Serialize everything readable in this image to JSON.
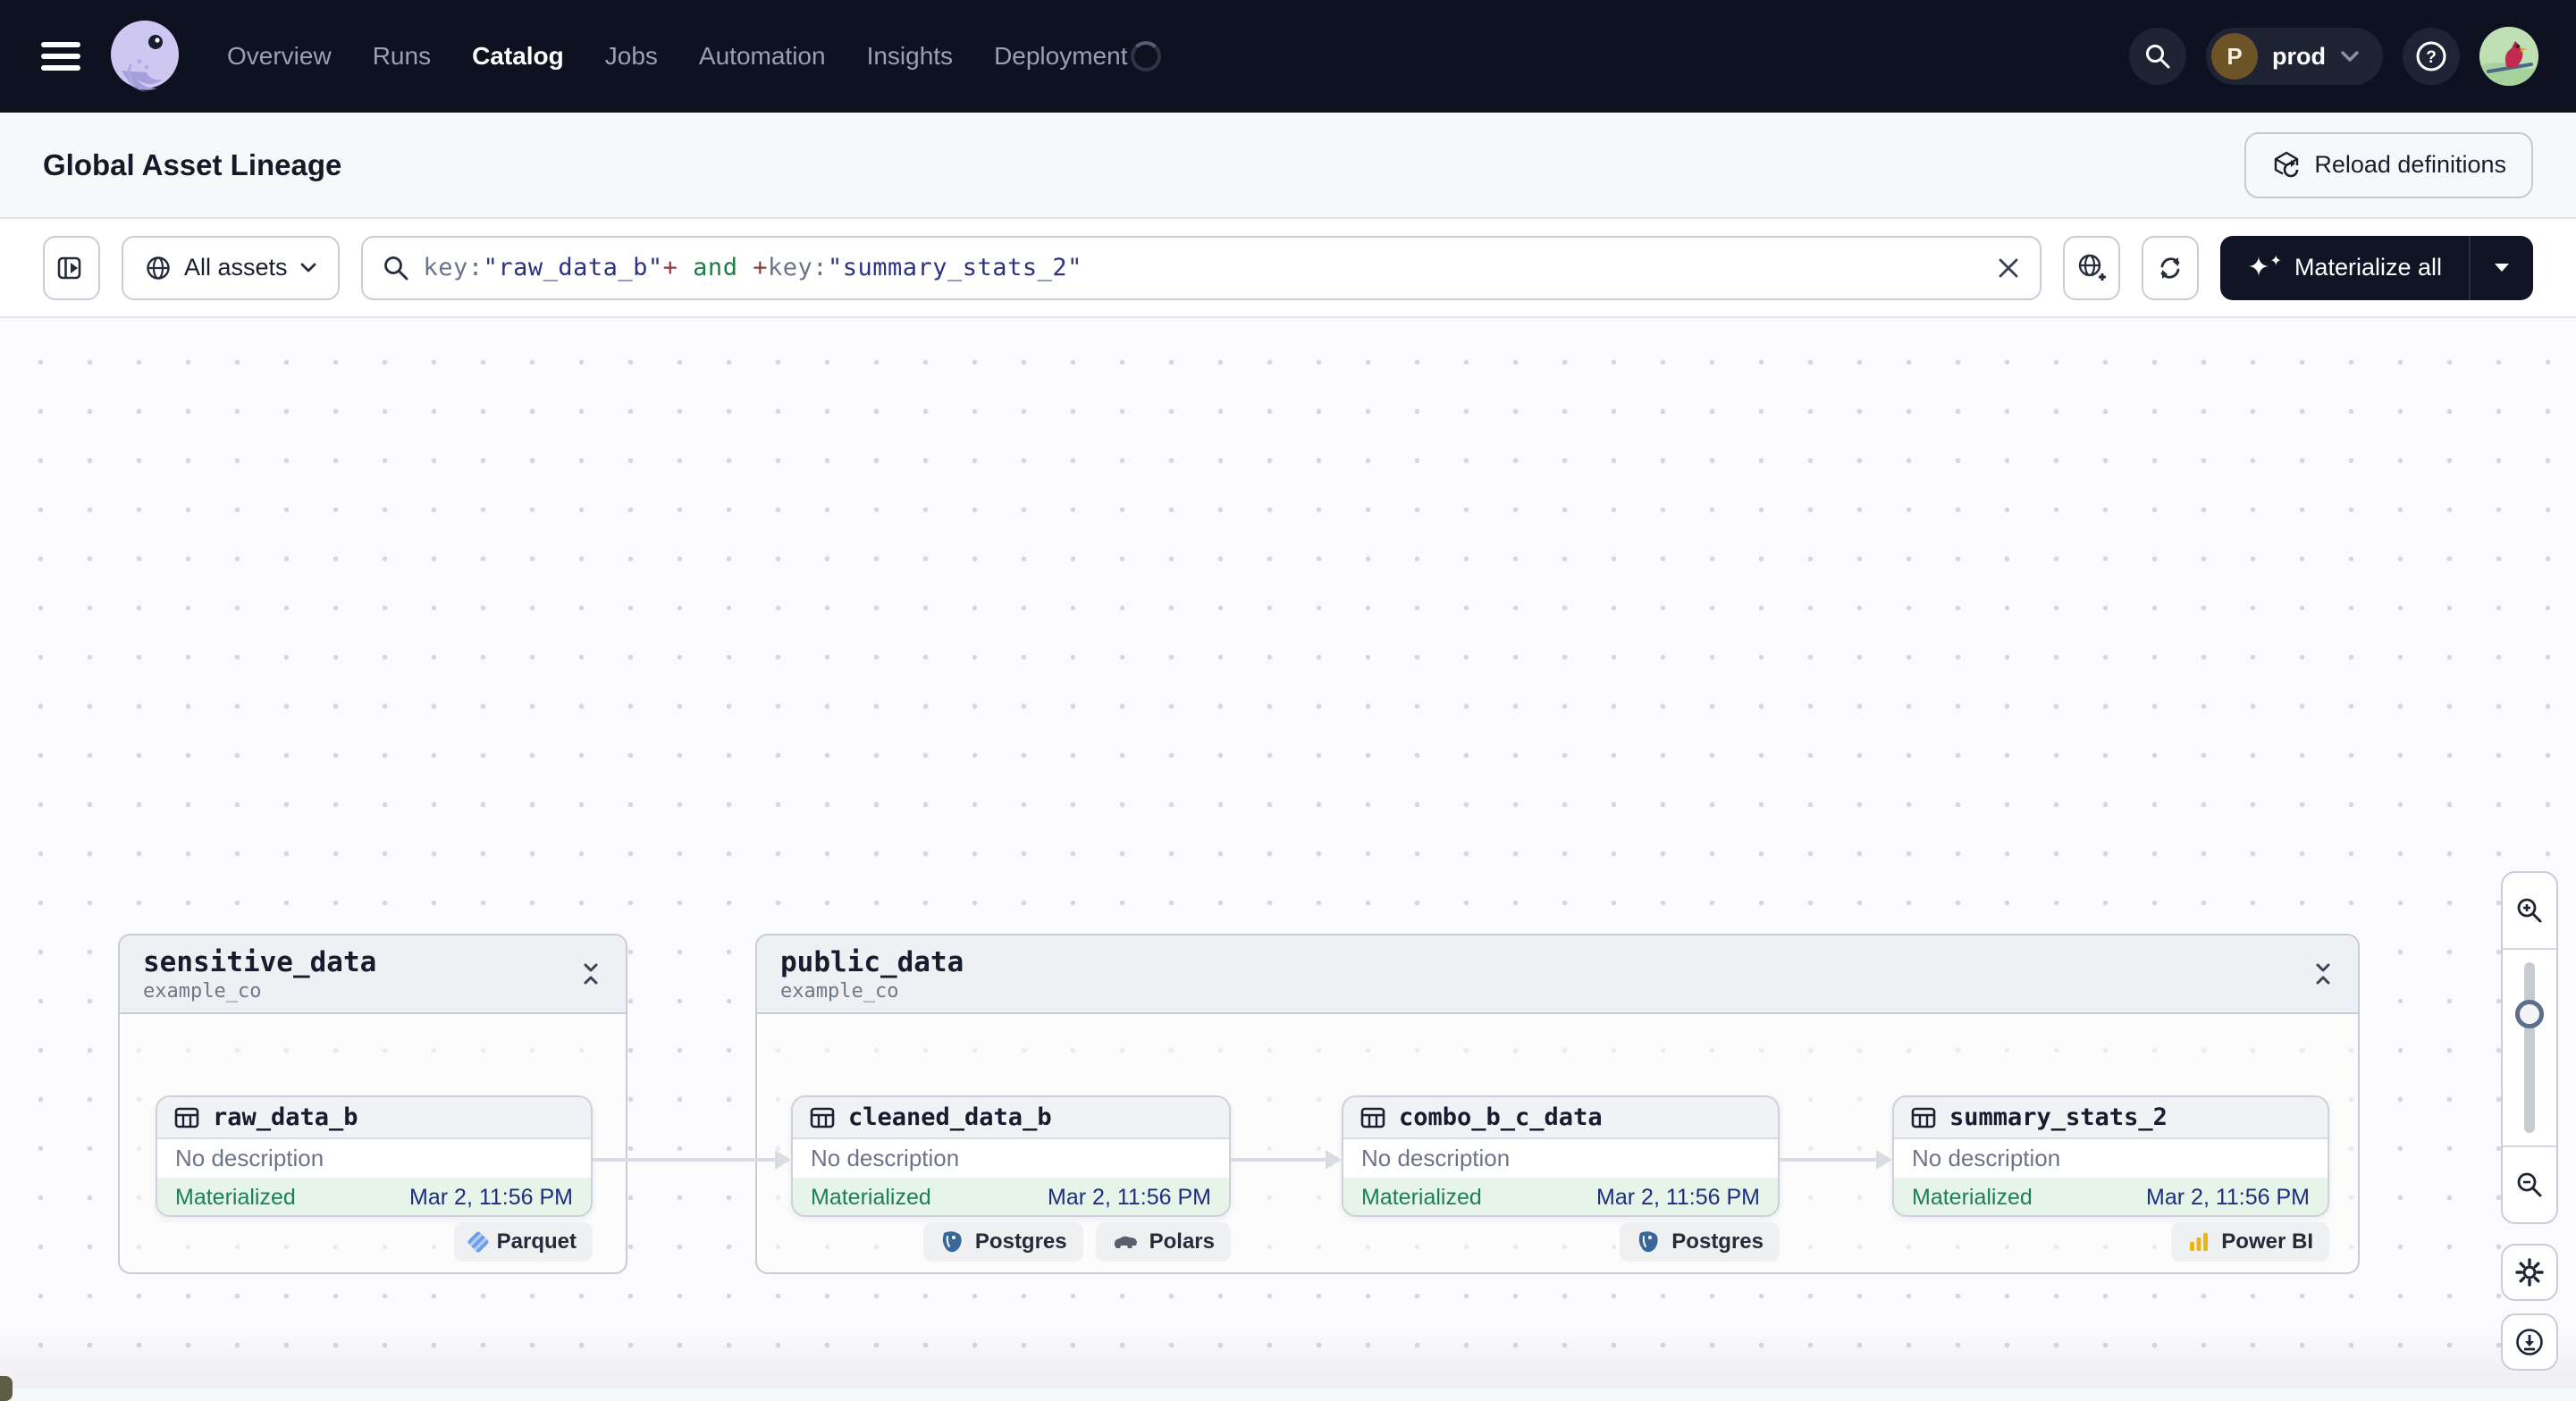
{
  "topbar": {
    "nav_items": [
      {
        "label": "Overview",
        "active": false
      },
      {
        "label": "Runs",
        "active": false
      },
      {
        "label": "Catalog",
        "active": true
      },
      {
        "label": "Jobs",
        "active": false
      },
      {
        "label": "Automation",
        "active": false
      },
      {
        "label": "Insights",
        "active": false
      },
      {
        "label": "Deployment",
        "active": false
      }
    ],
    "deployment": {
      "initial": "P",
      "name": "prod"
    }
  },
  "header": {
    "title": "Global Asset Lineage",
    "reload_button_label": "Reload definitions"
  },
  "toolbar": {
    "filter_label": "All assets",
    "search": {
      "tokens": [
        {
          "text": "key:",
          "type": "k"
        },
        {
          "text": "\"raw_data_b\"",
          "type": "s"
        },
        {
          "text": "+",
          "type": "o"
        },
        {
          "text": " and ",
          "type": "a"
        },
        {
          "text": "+",
          "type": "o"
        },
        {
          "text": "key:",
          "type": "k"
        },
        {
          "text": "\"summary_stats_2\"",
          "type": "s"
        }
      ]
    },
    "materialize_label": "Materialize all"
  },
  "graph": {
    "groups": [
      {
        "name": "sensitive_data",
        "repo": "example_co",
        "assets": [
          {
            "name": "raw_data_b",
            "description": "No description",
            "status": "Materialized",
            "timestamp": "Mar 2, 11:56 PM",
            "tags": [
              "Parquet"
            ]
          }
        ]
      },
      {
        "name": "public_data",
        "repo": "example_co",
        "assets": [
          {
            "name": "cleaned_data_b",
            "description": "No description",
            "status": "Materialized",
            "timestamp": "Mar 2, 11:56 PM",
            "tags": [
              "Postgres",
              "Polars"
            ]
          },
          {
            "name": "combo_b_c_data",
            "description": "No description",
            "status": "Materialized",
            "timestamp": "Mar 2, 11:56 PM",
            "tags": [
              "Postgres"
            ]
          },
          {
            "name": "summary_stats_2",
            "description": "No description",
            "status": "Materialized",
            "timestamp": "Mar 2, 11:56 PM",
            "tags": [
              "Power BI"
            ]
          }
        ]
      }
    ],
    "edges": [
      [
        "raw_data_b",
        "cleaned_data_b"
      ],
      [
        "cleaned_data_b",
        "combo_b_c_data"
      ],
      [
        "combo_b_c_data",
        "summary_stats_2"
      ]
    ]
  },
  "colors": {
    "topbar_bg": "#0d1120",
    "primary_button_bg": "#101525",
    "status_green": "#1d8050",
    "timestamp_navy": "#1d2e7d",
    "query_keyword": "#6b7486",
    "query_string": "#2d3380",
    "query_operator": "#8c3a3a",
    "query_logical": "#1e7e45"
  }
}
